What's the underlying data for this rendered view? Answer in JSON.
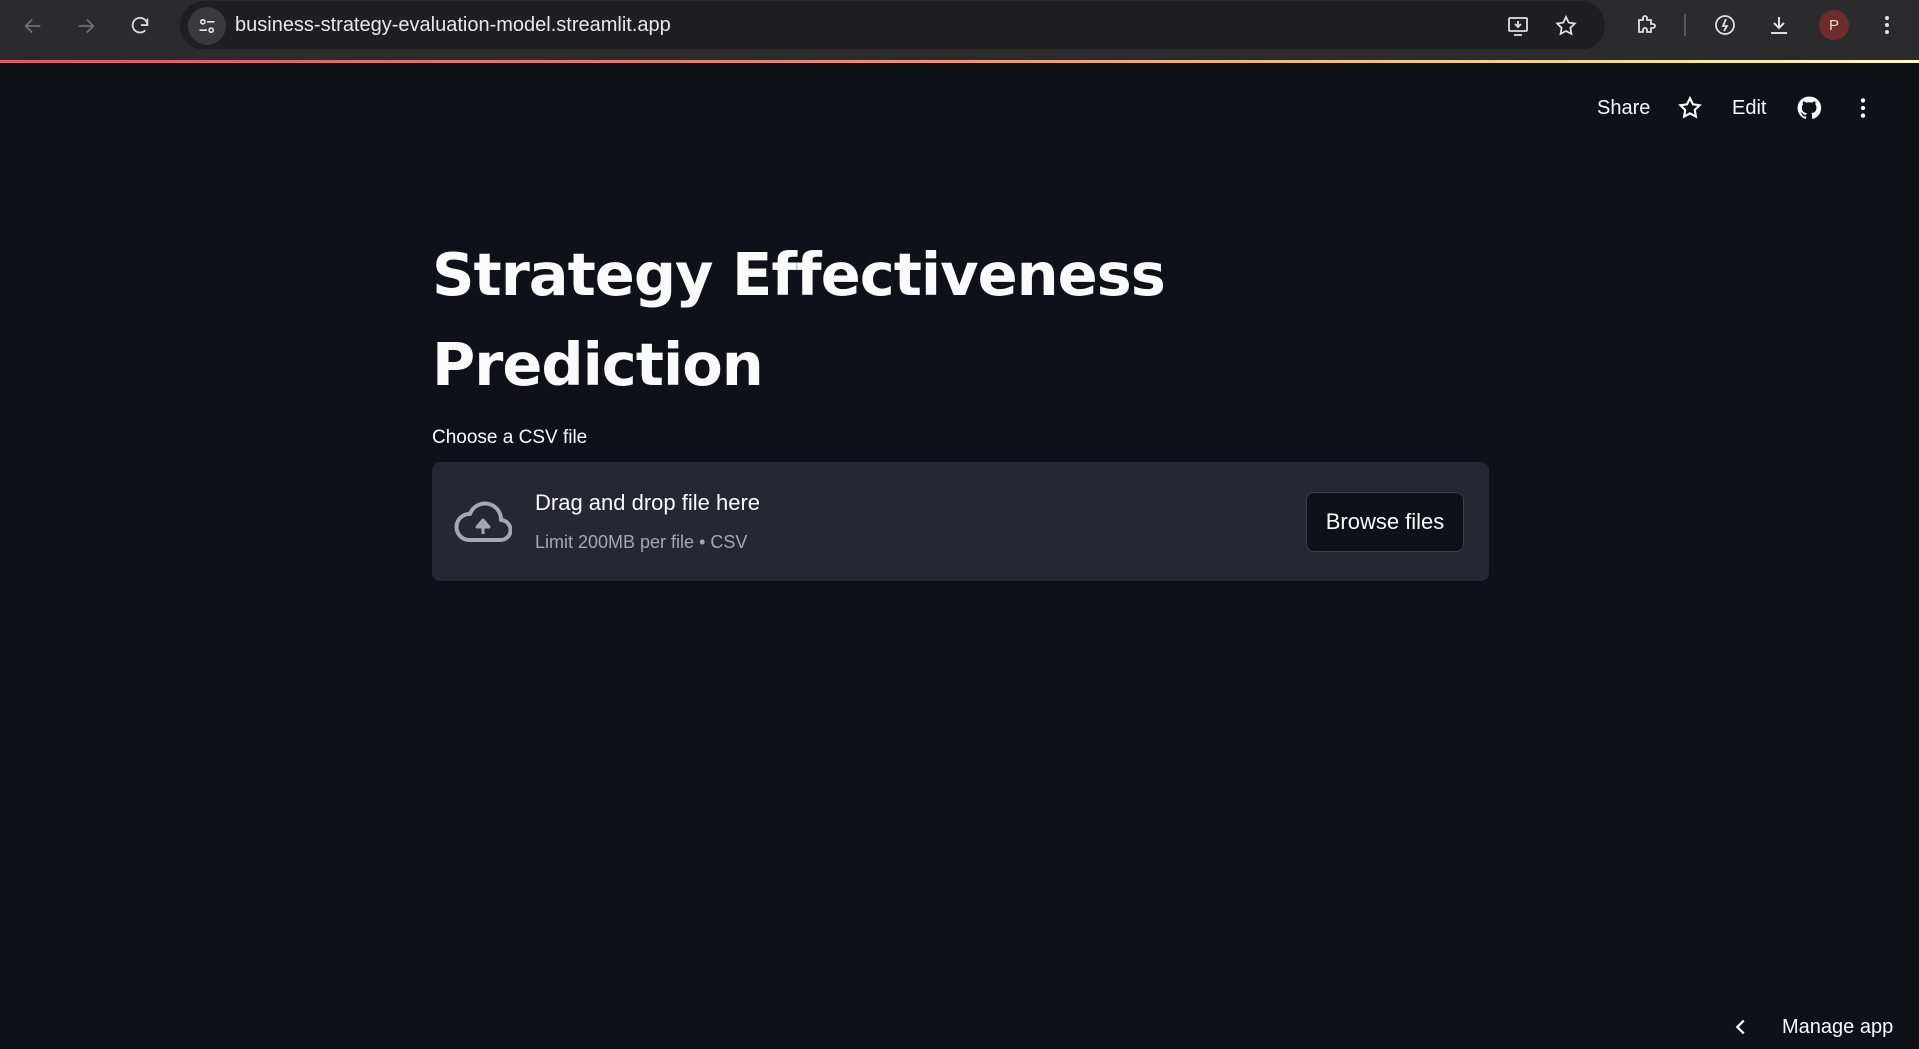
{
  "browser": {
    "url": "business-strategy-evaluation-model.streamlit.app",
    "profile_initial": "P"
  },
  "header": {
    "share_label": "Share",
    "edit_label": "Edit"
  },
  "main": {
    "title": "Strategy Effectiveness Prediction",
    "uploader": {
      "label": "Choose a CSV file",
      "drop_text": "Drag and drop file here",
      "limit_text": "Limit 200MB per file • CSV",
      "browse_label": "Browse files"
    }
  },
  "footer": {
    "manage_app_label": "Manage app"
  },
  "colors": {
    "background": "#0e1117",
    "dropzone": "#262730",
    "accent_gradient_start": "#ff4b4b",
    "accent_gradient_end": "#fffdb4"
  }
}
